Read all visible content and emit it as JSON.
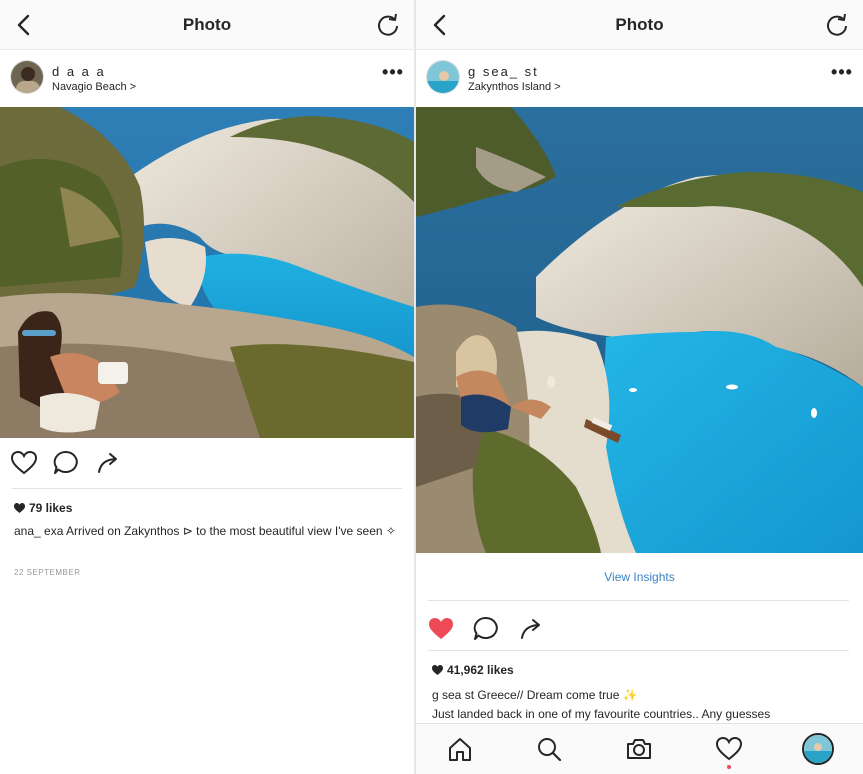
{
  "left": {
    "header": {
      "title": "Photo"
    },
    "post": {
      "username": "d a a a",
      "location": "Navagio Beach >",
      "likes": "79 likes",
      "caption": "ana_ exa Arrived on Zakynthos ⊳ to the most beautiful view I've seen ✧",
      "date": "22 SEPTEMBER"
    },
    "icons": [
      "back-icon",
      "refresh-icon",
      "more-icon",
      "heart-outline-icon",
      "comment-icon",
      "share-icon"
    ]
  },
  "right": {
    "header": {
      "title": "Photo"
    },
    "post": {
      "username": "g sea_ st",
      "location": "Zakynthos Island >",
      "view_insights": "View Insights",
      "likes": "41,962 likes",
      "caption_line1": "g sea st Greece// Dream come true ✨",
      "caption_line2": "Just landed back in one of my favourite countries.. Any guesses"
    },
    "liked": true,
    "tabbar": [
      "home-icon",
      "search-icon",
      "camera-icon",
      "activity-icon",
      "profile-avatar"
    ]
  },
  "colors": {
    "like_red": "#ed4956",
    "link_blue": "#3b82c4",
    "sea_blue": "#1aa3d6",
    "deep_sea": "#1f5e8a",
    "cliff": "#d8d2c4",
    "vegetation": "#5c6b2e"
  }
}
